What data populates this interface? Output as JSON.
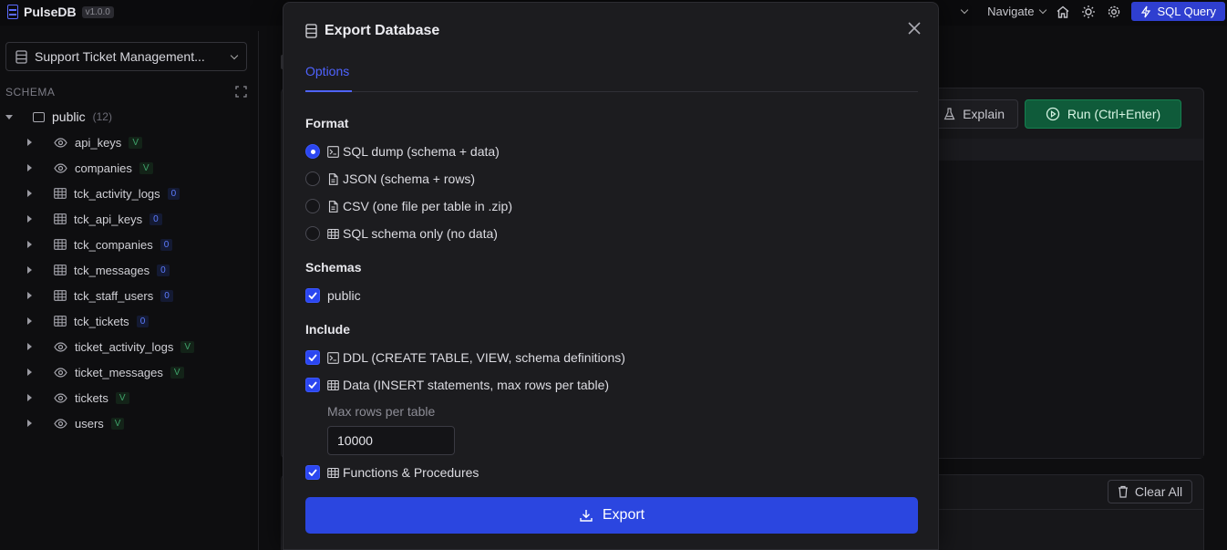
{
  "app": {
    "name": "PulseDB",
    "version": "v1.0.0"
  },
  "topbar": {
    "navigate_label": "Navigate",
    "sql_query_label": "SQL Query"
  },
  "sidebar": {
    "database": "Support Ticket Management...",
    "schema_heading": "SCHEMA",
    "root": {
      "label": "public",
      "count": "(12)"
    },
    "items": [
      {
        "label": "api_keys",
        "kind": "view",
        "badge": "V"
      },
      {
        "label": "companies",
        "kind": "view",
        "badge": "V"
      },
      {
        "label": "tck_activity_logs",
        "kind": "table",
        "badge": "0"
      },
      {
        "label": "tck_api_keys",
        "kind": "table",
        "badge": "0"
      },
      {
        "label": "tck_companies",
        "kind": "table",
        "badge": "0"
      },
      {
        "label": "tck_messages",
        "kind": "table",
        "badge": "0"
      },
      {
        "label": "tck_staff_users",
        "kind": "table",
        "badge": "0"
      },
      {
        "label": "tck_tickets",
        "kind": "table",
        "badge": "0"
      },
      {
        "label": "ticket_activity_logs",
        "kind": "view",
        "badge": "V"
      },
      {
        "label": "ticket_messages",
        "kind": "view",
        "badge": "V"
      },
      {
        "label": "tickets",
        "kind": "view",
        "badge": "V"
      },
      {
        "label": "users",
        "kind": "view",
        "badge": "V"
      }
    ]
  },
  "editor": {
    "explain_label": "Explain",
    "run_label": "Run (Ctrl+Enter)"
  },
  "results": {
    "clear_label": "Clear All"
  },
  "modal": {
    "title": "Export Database",
    "tab": "Options",
    "format_heading": "Format",
    "formats": [
      {
        "label": "SQL dump (schema + data)",
        "icon": "terminal-icon",
        "selected": true
      },
      {
        "label": "JSON (schema + rows)",
        "icon": "file-icon",
        "selected": false
      },
      {
        "label": "CSV (one file per table in .zip)",
        "icon": "file-icon",
        "selected": false
      },
      {
        "label": "SQL schema only (no data)",
        "icon": "table-icon",
        "selected": false
      }
    ],
    "schemas_heading": "Schemas",
    "schemas": [
      {
        "label": "public",
        "checked": true
      }
    ],
    "include_heading": "Include",
    "include": {
      "ddl": {
        "label": "DDL (CREATE TABLE, VIEW, schema definitions)",
        "checked": true
      },
      "data": {
        "label": "Data (INSERT statements, max rows per table)",
        "checked": true
      },
      "functions": {
        "label": "Functions & Procedures",
        "checked": true
      }
    },
    "max_rows_label": "Max rows per table",
    "max_rows_value": "10000",
    "export_label": "Export"
  },
  "colors": {
    "accent": "#2b46e0",
    "run": "#0f5b3a",
    "view_badge": "#3fa36b",
    "table_badge": "#5d7cff"
  }
}
